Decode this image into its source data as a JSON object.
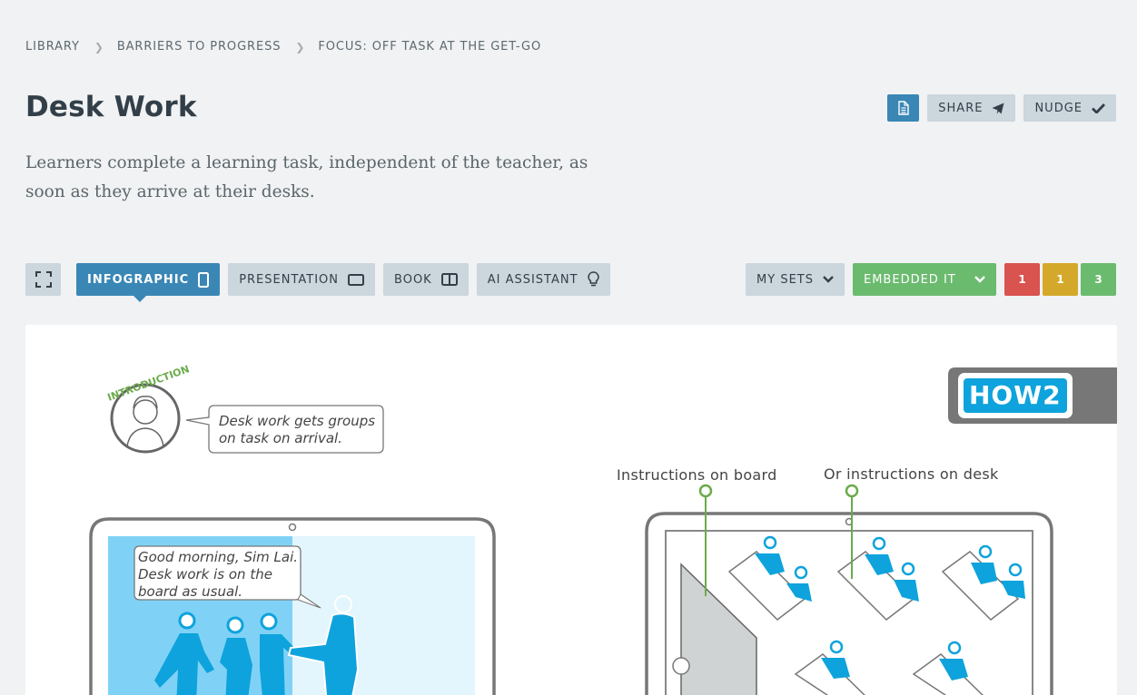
{
  "breadcrumb": [
    "LIBRARY",
    "BARRIERS TO PROGRESS",
    "FOCUS: OFF TASK AT THE GET-GO"
  ],
  "page": {
    "title": "Desk Work",
    "description": "Learners complete a learning task, independent of the teacher, as soon as they arrive at their desks."
  },
  "actions": {
    "share": "SHARE",
    "nudge": "NUDGE"
  },
  "tabs": {
    "infographic": "INFOGRAPHIC",
    "presentation": "PRESENTATION",
    "book": "BOOK",
    "ai_assistant": "AI ASSISTANT"
  },
  "sets": {
    "my_sets": "MY SETS",
    "embedded": "EMBEDDED IT"
  },
  "counts": [
    {
      "value": "1",
      "color": "#d9534f"
    },
    {
      "value": "1",
      "color": "#d4a92b"
    },
    {
      "value": "3",
      "color": "#6bbb6f"
    }
  ],
  "infographic": {
    "intro_badge": "INTRODUCTION",
    "intro_bubble_1": "Desk work gets groups",
    "intro_bubble_2": "on task on arrival.",
    "logo": "HOW2",
    "label_board": "Instructions on board",
    "label_desk": "Or instructions on desk",
    "teacher_bubble_1": "Good morning, Sim Lai.",
    "teacher_bubble_2": "Desk work is on the",
    "teacher_bubble_3": "board as usual.",
    "accent_blue": "#0ea3dc",
    "accent_green": "#6aab4a"
  }
}
